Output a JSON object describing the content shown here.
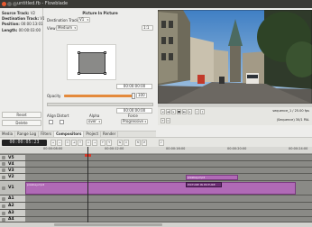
{
  "window": {
    "title": "untitled.fb - Flowblade"
  },
  "clip_info": {
    "source_track_label": "Source Track:",
    "source_track_value": "V2",
    "dest_track_label": "Destination Track:",
    "dest_track_value": "V1",
    "position_label": "Position:",
    "position_value": "00:00:13:01",
    "length_label": "Length:",
    "length_value": "00:00:03:00",
    "reset_label": "Reset",
    "delete_label": "Delete"
  },
  "compositor": {
    "title": "Picture In Picture",
    "dest_track_label": "Destination Track:",
    "dest_track_value": "V1",
    "view_label": "View",
    "view_value": "Medium",
    "zoom_value": "1:1",
    "timecode_top": "00:00:00:00",
    "opacity_label": "Opacity",
    "opacity_value": "100",
    "opacity_fraction": 1.0,
    "timecode_bottom": "00:00:00:00",
    "align_label": "Align",
    "distort_label": "Distort",
    "alpha_label": "Alpha",
    "alpha_value": "over",
    "force_label": "Force",
    "force_value": "Progressive"
  },
  "panel_tabs": [
    "Media",
    "Range Log",
    "Filters",
    "Compositors",
    "Project",
    "Render"
  ],
  "monitor": {
    "sequence_label": "sequence_1 / 25.00 fps",
    "format_label": "(Sequence) 30/1 PAL"
  },
  "toolbar": {
    "timecode": "00:00:05:23"
  },
  "timeline": {
    "ruler_labels": [
      "00:00:08:00",
      "00:00:12:00",
      "00:00:16:00",
      "00:00:20:00",
      "00:00:24:00"
    ],
    "tracks": [
      "V5",
      "V4",
      "V3",
      "V2",
      "V1",
      "A1",
      "A2",
      "A3",
      "A4"
    ],
    "clip_v1_label": "pixabay.mp4",
    "clip_v2_label": "pixabay.mp4",
    "compositor_label": "PICTURE IN PICTURE"
  },
  "colors": {
    "accent_orange": "#e48a3c",
    "clip_purple": "#b06ab6",
    "compositor_bar": "#6c2e74"
  }
}
